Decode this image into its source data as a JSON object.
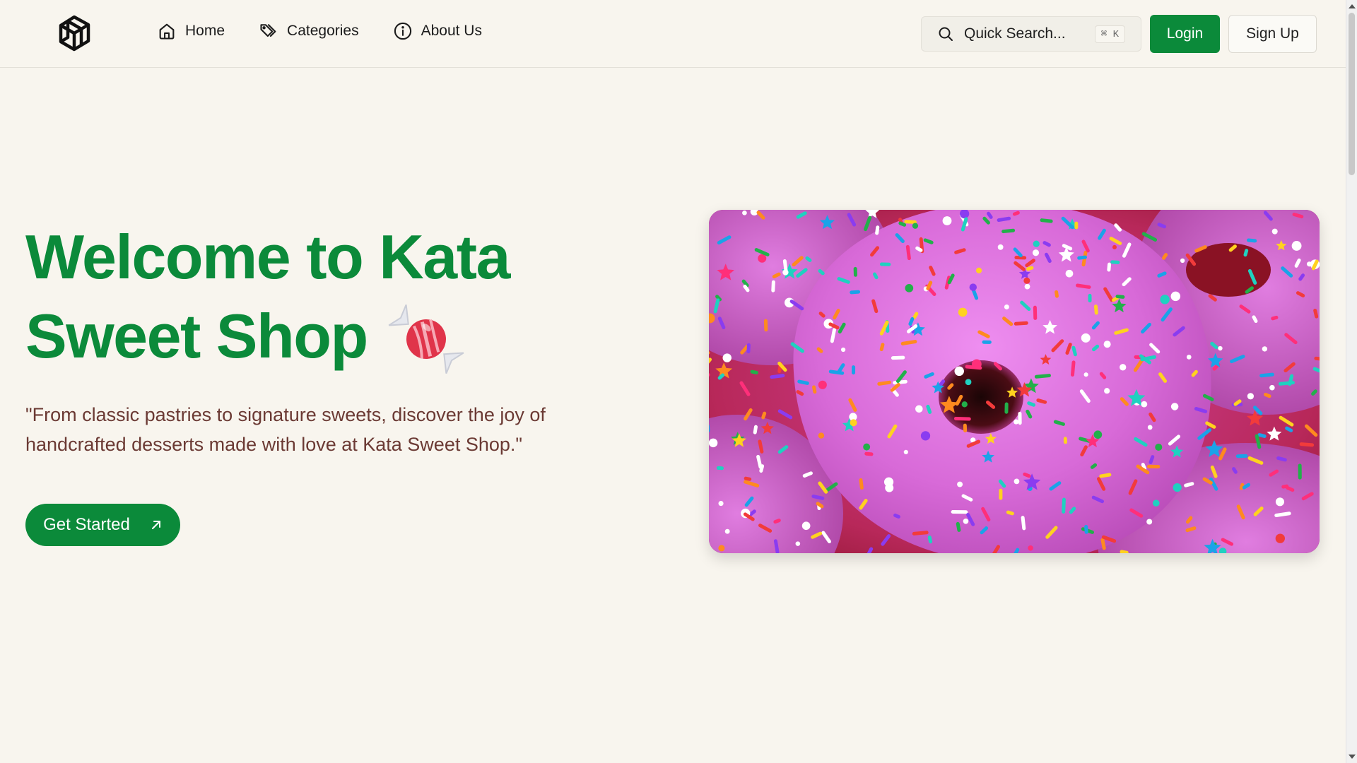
{
  "header": {
    "nav": [
      {
        "label": "Home",
        "icon": "home-icon"
      },
      {
        "label": "Categories",
        "icon": "tag-icon"
      },
      {
        "label": "About Us",
        "icon": "info-icon"
      }
    ],
    "search": {
      "label": "Quick Search...",
      "shortcut": "⌘ K"
    },
    "login_label": "Login",
    "signup_label": "Sign Up"
  },
  "hero": {
    "title": "Welcome to Kata Sweet Shop",
    "subtitle": "\"From classic pastries to signature sweets, discover the joy of handcrafted desserts made with love at Kata Sweet Shop.\"",
    "cta_label": "Get Started",
    "image_icon": "donut-photo"
  },
  "colors": {
    "brand_green": "#0b8a3a",
    "background": "#f8f5ee",
    "subtitle_brown": "#6b3a34"
  }
}
